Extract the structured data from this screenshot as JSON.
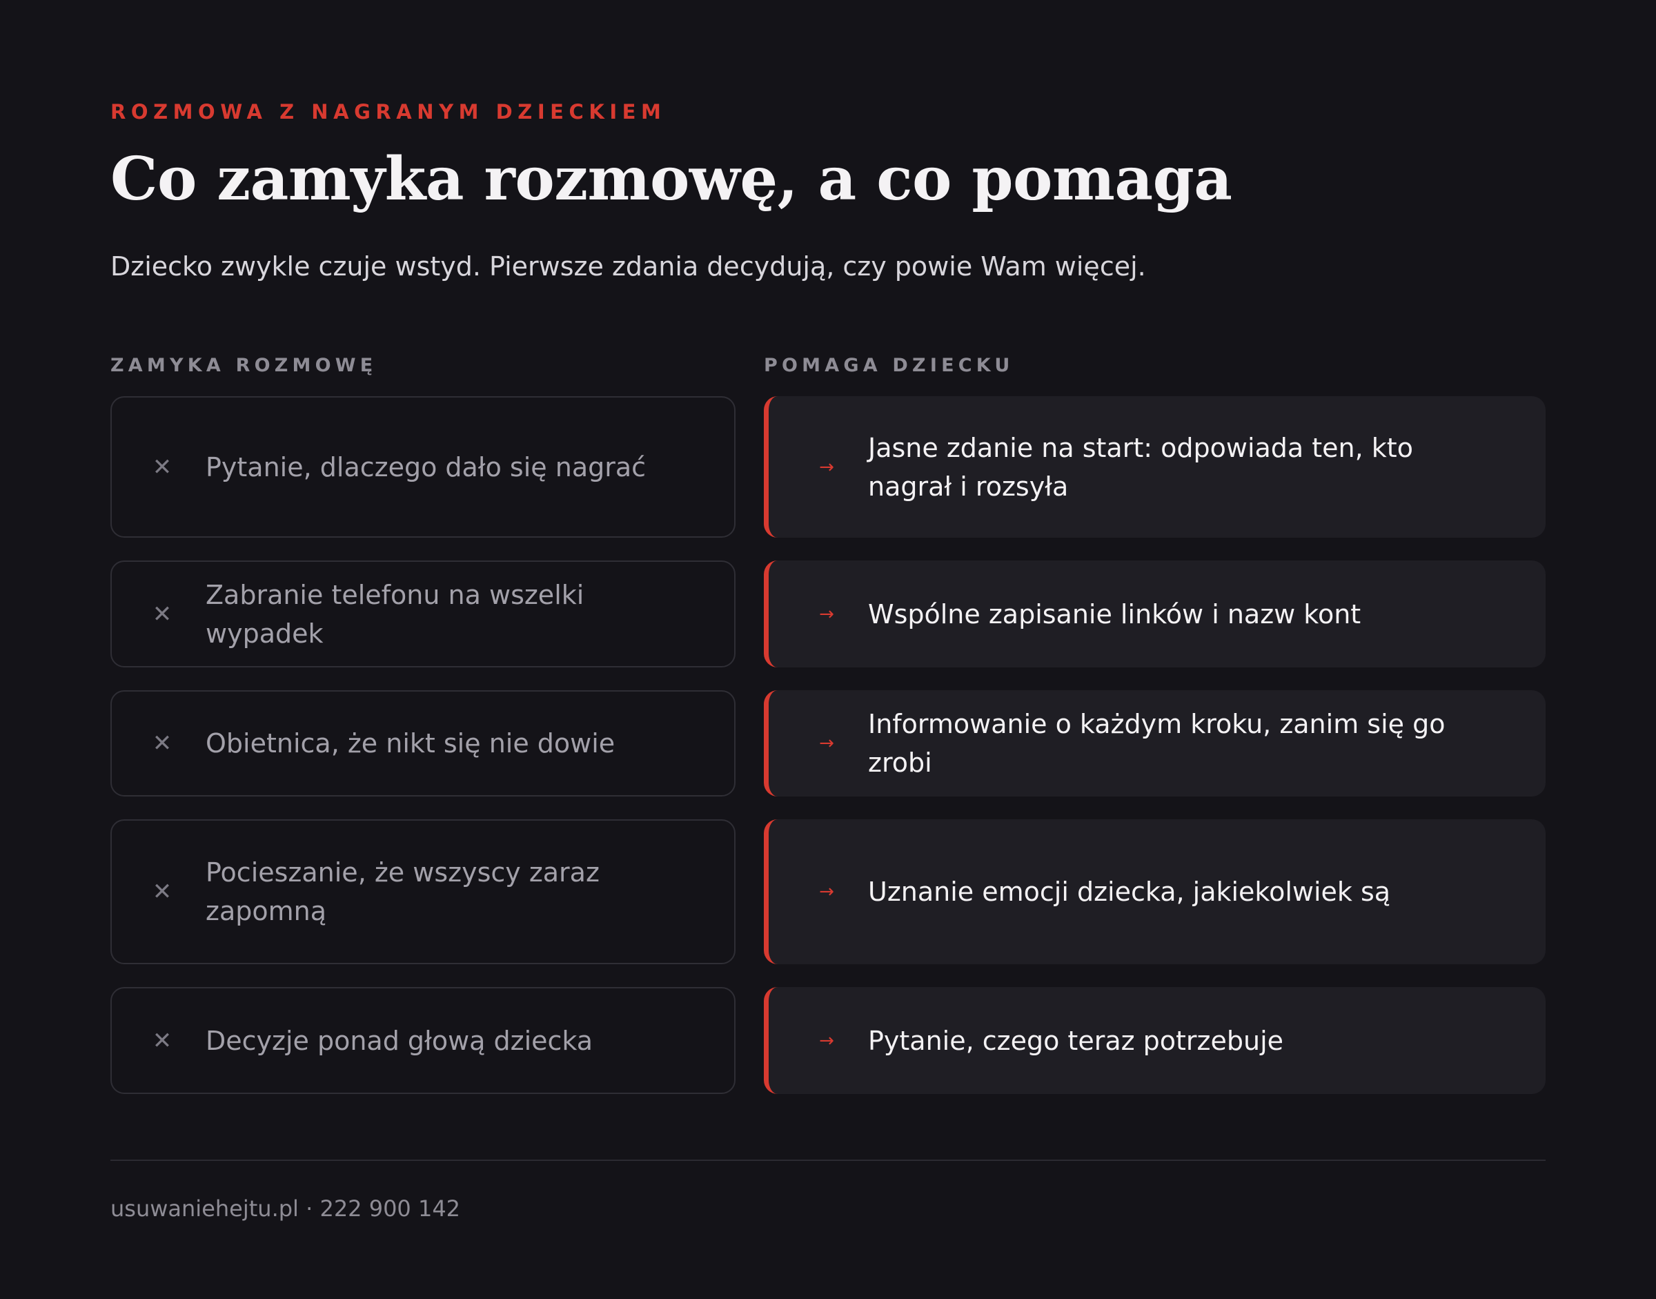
{
  "header": {
    "eyebrow": "ROZMOWA Z NAGRANYM DZIECKIEM",
    "title": "Co zamyka rozmowę, a co pomaga",
    "subtitle": "Dziecko zwykle czuje wstyd. Pierwsze zdania decydują, czy powie Wam więcej."
  },
  "columns": {
    "left_heading": "ZAMYKA ROZMOWĘ",
    "right_heading": "POMAGA DZIECKU"
  },
  "marks": {
    "bad": "✕",
    "good": "→"
  },
  "rows": [
    {
      "bad": "Pytanie, dlaczego dało się nagrać",
      "good": "Jasne zdanie na start: odpowiada ten, kto nagrał i rozsyła"
    },
    {
      "bad": "Zabranie telefonu na wszelki wypadek",
      "good": "Wspólne zapisanie linków i nazw kont"
    },
    {
      "bad": "Obietnica, że nikt się nie dowie",
      "good": "Informowanie o każdym kroku, zanim się go zrobi"
    },
    {
      "bad": "Pocieszanie, że wszyscy zaraz zapomną",
      "good": "Uznanie emocji dziecka, jakiekolwiek są"
    },
    {
      "bad": "Decyzje ponad głową dziecka",
      "good": "Pytanie, czego teraz potrzebuje"
    }
  ],
  "colors": {
    "accent": "#d83a30",
    "background": "#141318",
    "good_card": "#1f1e24"
  },
  "footer": {
    "text": "usuwaniehejtu.pl · 222 900 142"
  }
}
